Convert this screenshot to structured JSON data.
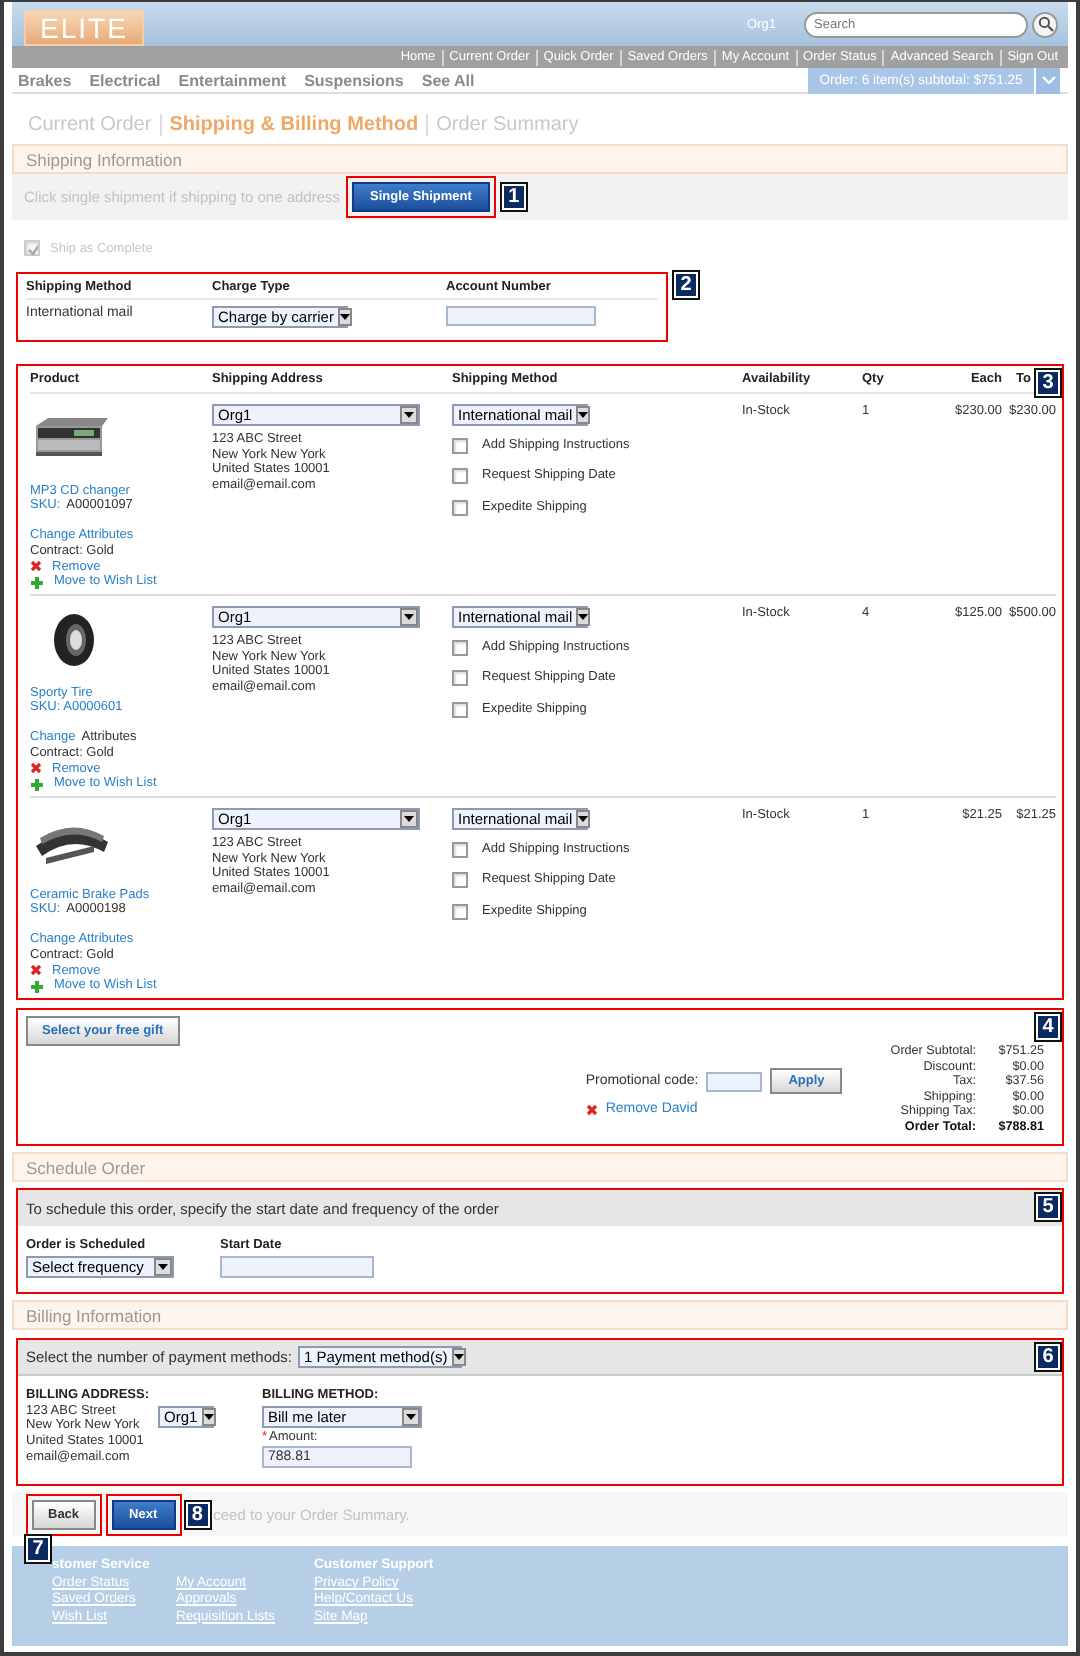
{
  "header": {
    "logo": "ELITE",
    "org": "Org1",
    "search": {
      "placeholder": "Search"
    }
  },
  "top_links": [
    "Home",
    "Current Order",
    "Quick Order",
    "Saved Orders",
    "My Account",
    "Order Status",
    "Advanced Search",
    "Sign Out"
  ],
  "categories": [
    "Brakes",
    "Electrical",
    "Entertainment",
    "Suspensions",
    "See All"
  ],
  "order_summary": "Order: 6 item(s) subtotal: $751.25",
  "breadcrumb": [
    {
      "label": "Current Order",
      "selected": false
    },
    {
      "label": "Shipping & Billing Method",
      "selected": true
    },
    {
      "label": "Order Summary",
      "selected": false
    }
  ],
  "shipping": {
    "title": "Shipping Information",
    "hint": "Click single shipment if shipping to one address",
    "button": "Single Shipment",
    "marker": "1",
    "ship_complete": {
      "label": "Ship as Complete",
      "checked": true,
      "disabled": true
    }
  },
  "shipping_method": {
    "marker": "2",
    "columns": [
      "Shipping Method",
      "Charge Type",
      "Account Number"
    ],
    "method": "International mail",
    "charge_type": "Charge by carrier"
  },
  "items": {
    "marker": "3",
    "columns": [
      "Product",
      "Shipping Address",
      "Shipping Method",
      "Availability",
      "Qty",
      "Each",
      "To"
    ],
    "rows": [
      {
        "name": "MP3 CD changer",
        "sku": [
          {
            "text": "SKU:",
            "link": true
          },
          {
            "text": "A00001097",
            "link": false
          }
        ],
        "attributes": [
          {
            "text": "Change Attributes",
            "link": true
          }
        ],
        "contract": "Contract: Gold",
        "remove": "Remove",
        "wish_list": "Move to Wish List",
        "address_select": "Org1",
        "address": [
          "123 ABC Street",
          "New York New York",
          "United States 10001",
          "email@email.com"
        ],
        "method_select": "International mail",
        "options": [
          {
            "label": "Add Shipping Instructions",
            "checked": false
          },
          {
            "label": "Request Shipping Date",
            "checked": false
          },
          {
            "label": "Expedite Shipping",
            "checked": false
          }
        ],
        "availability": "In-Stock",
        "qty": "1",
        "each": "$230.00",
        "total": "$230.00"
      },
      {
        "name": "Sporty Tire",
        "sku": [
          {
            "text": "SKU: A0000601",
            "link": true
          }
        ],
        "attributes": [
          {
            "text": "Change",
            "link": true
          },
          {
            "text": "Attributes",
            "link": false
          }
        ],
        "contract": "Contract: Gold",
        "remove": "Remove",
        "wish_list": "Move to Wish List",
        "address_select": "Org1",
        "address": [
          "123 ABC Street",
          "New York New York",
          "United States 10001",
          "email@email.com"
        ],
        "method_select": "International mail",
        "options": [
          {
            "label": "Add Shipping Instructions",
            "checked": false
          },
          {
            "label": "Request Shipping Date",
            "checked": false
          },
          {
            "label": "Expedite Shipping",
            "checked": false
          }
        ],
        "availability": "In-Stock",
        "qty": "4",
        "each": "$125.00",
        "total": "$500.00"
      },
      {
        "name": "Ceramic Brake Pads",
        "sku": [
          {
            "text": "SKU:",
            "link": true
          },
          {
            "text": "A0000198",
            "link": false
          }
        ],
        "attributes": [
          {
            "text": "Change Attributes",
            "link": true
          }
        ],
        "contract": "Contract: Gold",
        "remove": "Remove",
        "wish_list": "Move to Wish List",
        "address_select": "Org1",
        "address": [
          "123 ABC Street",
          "New York New York",
          "United States 10001",
          "email@email.com"
        ],
        "method_select": "International mail",
        "options": [
          {
            "label": "Add Shipping Instructions",
            "checked": false
          },
          {
            "label": "Request Shipping Date",
            "checked": false
          },
          {
            "label": "Expedite Shipping",
            "checked": false
          }
        ],
        "availability": "In-Stock",
        "qty": "1",
        "each": "$21.25",
        "total": "$21.25"
      }
    ]
  },
  "promotions": {
    "marker": "4",
    "gift_button": "Select your free gift",
    "promo_label": "Promotional code:",
    "apply": "Apply",
    "remove_promo": "Remove David",
    "totals": [
      {
        "label": "Order Subtotal:",
        "value": "$751.25",
        "bold": false
      },
      {
        "label": "Discount:",
        "value": "$0.00",
        "bold": false
      },
      {
        "label": "Tax:",
        "value": "$37.56",
        "bold": false
      },
      {
        "label": "Shipping:",
        "value": "$0.00",
        "bold": false
      },
      {
        "label": "Shipping Tax:",
        "value": "$0.00",
        "bold": false
      },
      {
        "label": "Order Total:",
        "value": "$788.81",
        "bold": true
      }
    ]
  },
  "schedule": {
    "title": "Schedule Order",
    "marker": "5",
    "intro": "To schedule this order, specify the start date and frequency of the order",
    "frequency_label": "Order is Scheduled",
    "frequency_select": "Select frequency",
    "start_label": "Start Date"
  },
  "billing": {
    "title": "Billing Information",
    "marker": "6",
    "prompt": "Select the number of payment methods:",
    "count_select": "1 Payment method(s)",
    "address_label": "BILLING ADDRESS:",
    "address": [
      "123 ABC Street",
      "New York New York",
      "United States 10001",
      "email@email.com"
    ],
    "address_select": "Org1",
    "method_label": "BILLING METHOD:",
    "method_select": "Bill me later",
    "required_mark": "*",
    "amount_label": "Amount:",
    "amount": "788.81"
  },
  "actions": {
    "back": "Back",
    "back_marker": "7",
    "next": "Next",
    "next_marker": "8",
    "hint": "ceed to your Order Summary."
  },
  "footer": {
    "groups": [
      {
        "title": "stomer Service",
        "columns": [
          [
            "Order Status",
            "Saved Orders",
            "Wish List"
          ],
          [
            "My Account",
            "Approvals",
            "Requisition Lists"
          ]
        ]
      },
      {
        "title": "Customer Support",
        "columns": [
          [
            "Privacy Policy",
            "Help/Contact Us",
            "Site Map"
          ]
        ]
      }
    ]
  }
}
